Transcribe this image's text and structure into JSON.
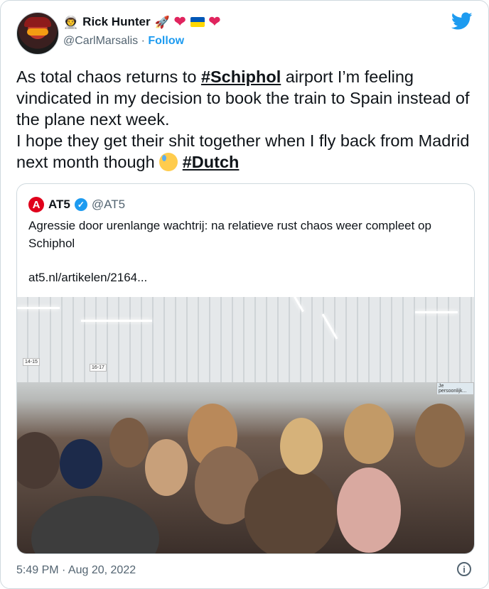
{
  "author": {
    "name": "Rick Hunter",
    "handle": "@CarlMarsalis",
    "separator": "·",
    "follow_label": "Follow",
    "name_emojis": [
      "crown-person-emoji",
      "rocket-emoji",
      "red-heart-emoji",
      "ukraine-flag-emoji",
      "red-heart-emoji"
    ]
  },
  "tweet": {
    "line1_pre": "As total chaos returns to ",
    "hashtag1": "#Schiphol",
    "line1_post": " airport I’m feeling vindicated in my decision to book the train to Spain instead of the plane next week.",
    "line2_pre": "I hope they get their shit together when I fly back from Madrid next month though ",
    "hashtag2": "#Dutch"
  },
  "quote": {
    "logo_letter": "A",
    "name": "AT5",
    "handle": "@AT5",
    "text": "Agressie door urenlange wachtrij: na relatieve rust chaos weer compleet op Schiphol",
    "link": "at5.nl/artikelen/2164...",
    "photo_signs": [
      "14-15",
      "16-17",
      "Je persoonlijk..."
    ]
  },
  "footer": {
    "timestamp": "5:49 PM · Aug 20, 2022",
    "info_glyph": "i"
  },
  "colors": {
    "accent": "#1d9bf0",
    "heart": "#e0245e",
    "secondary_text": "#536471",
    "border": "#cfd9de"
  }
}
